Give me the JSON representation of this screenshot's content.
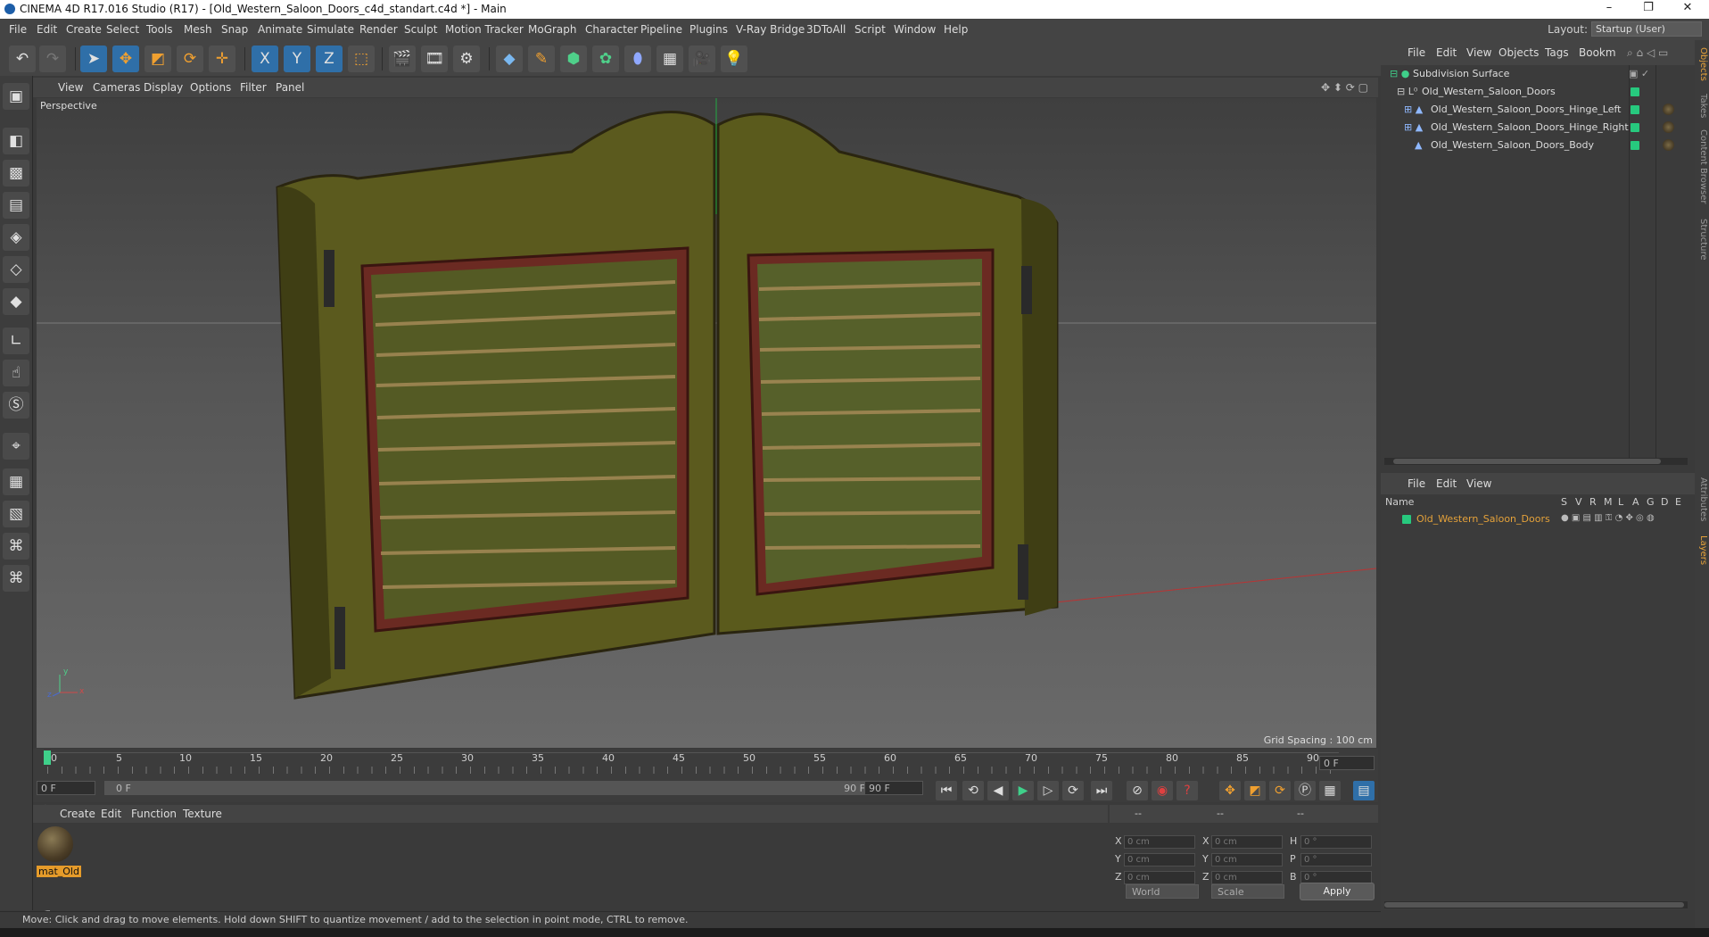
{
  "window": {
    "title": "CINEMA 4D R17.016 Studio (R17) - [Old_Western_Saloon_Doors_c4d_standart.c4d *] - Main",
    "controls": {
      "minimize": "–",
      "maximize": "❐",
      "close": "✕"
    }
  },
  "menubar": {
    "items": [
      "File",
      "Edit",
      "Create",
      "Select",
      "Tools",
      "Mesh",
      "Snap",
      "Animate",
      "Simulate",
      "Render",
      "Sculpt",
      "Motion Tracker",
      "MoGraph",
      "Character",
      "Pipeline",
      "Plugins",
      "V-Ray Bridge",
      "3DToAll",
      "Script",
      "Window",
      "Help"
    ],
    "layout_label": "Layout:",
    "layout_value": "Startup (User)"
  },
  "toolbar": {
    "icons": [
      "undo-icon",
      "redo-icon",
      "select-pointer-icon",
      "move-icon",
      "scale-icon",
      "rotate-icon",
      "transform-icon",
      "x-axis-icon",
      "y-axis-icon",
      "z-axis-icon",
      "world-coord-icon",
      "render-view-icon",
      "render-picture-icon",
      "render-settings-icon",
      "cube-icon",
      "pen-icon",
      "subdivision-icon",
      "cloner-icon",
      "deformer-icon",
      "floor-icon",
      "camera-icon",
      "light-icon"
    ],
    "axis_labels": [
      "X",
      "Y",
      "Z"
    ]
  },
  "viewport": {
    "menu": [
      "View",
      "Cameras",
      "Display",
      "Options",
      "Filter",
      "Panel"
    ],
    "label": "Perspective",
    "grid_spacing": "Grid Spacing : 100 cm",
    "axis": {
      "y": "y",
      "x": "x",
      "z": "z"
    }
  },
  "timeline": {
    "ticks": [
      "0",
      "5",
      "10",
      "15",
      "20",
      "25",
      "30",
      "35",
      "40",
      "45",
      "50",
      "55",
      "60",
      "65",
      "70",
      "75",
      "80",
      "85",
      "90"
    ],
    "current_frame": "0 F",
    "start_field": "0 F",
    "range_start": "0 F",
    "range_end": "90 F",
    "end_field": "90 F"
  },
  "material_manager": {
    "menu": [
      "Create",
      "Edit",
      "Function",
      "Texture"
    ],
    "materials": [
      {
        "name": "mat_Old"
      }
    ]
  },
  "coordinates": {
    "header": [
      "--",
      "--",
      "--"
    ],
    "rows": [
      {
        "a": "X",
        "av": "0 cm",
        "b": "X",
        "bv": "0 cm",
        "c": "H",
        "cv": "0 °"
      },
      {
        "a": "Y",
        "av": "0 cm",
        "b": "Y",
        "bv": "0 cm",
        "c": "P",
        "cv": "0 °"
      },
      {
        "a": "Z",
        "av": "0 cm",
        "b": "Z",
        "bv": "0 cm",
        "c": "B",
        "cv": "0 °"
      }
    ],
    "mode": "World",
    "type": "Scale",
    "apply": "Apply"
  },
  "status": "Move: Click and drag to move elements. Hold down SHIFT to quantize movement / add to the selection in point mode, CTRL to remove.",
  "object_manager": {
    "menu": [
      "File",
      "Edit",
      "View",
      "Objects",
      "Tags",
      "Bookm"
    ],
    "objects": [
      {
        "name": "Subdivision Surface"
      },
      {
        "name": "Old_Western_Saloon_Doors"
      },
      {
        "name": "Old_Western_Saloon_Doors_Hinge_Left"
      },
      {
        "name": "Old_Western_Saloon_Doors_Hinge_Right"
      },
      {
        "name": "Old_Western_Saloon_Doors_Body"
      }
    ]
  },
  "layer_manager": {
    "menu": [
      "File",
      "Edit",
      "View"
    ],
    "columns": [
      "Name",
      "S",
      "V",
      "R",
      "M",
      "L",
      "A",
      "G",
      "D",
      "E"
    ],
    "layers": [
      {
        "name": "Old_Western_Saloon_Doors",
        "color": "#27c97e"
      }
    ]
  },
  "side_tabs": [
    "Objects",
    "Takes",
    "Content Browser",
    "Structure",
    "Attributes",
    "Layers"
  ],
  "colors": {
    "accent": "#2f6fa8",
    "layer_name": "#e5a23a",
    "object_dot": "#27c97e",
    "material_label": "#e59b2a"
  }
}
